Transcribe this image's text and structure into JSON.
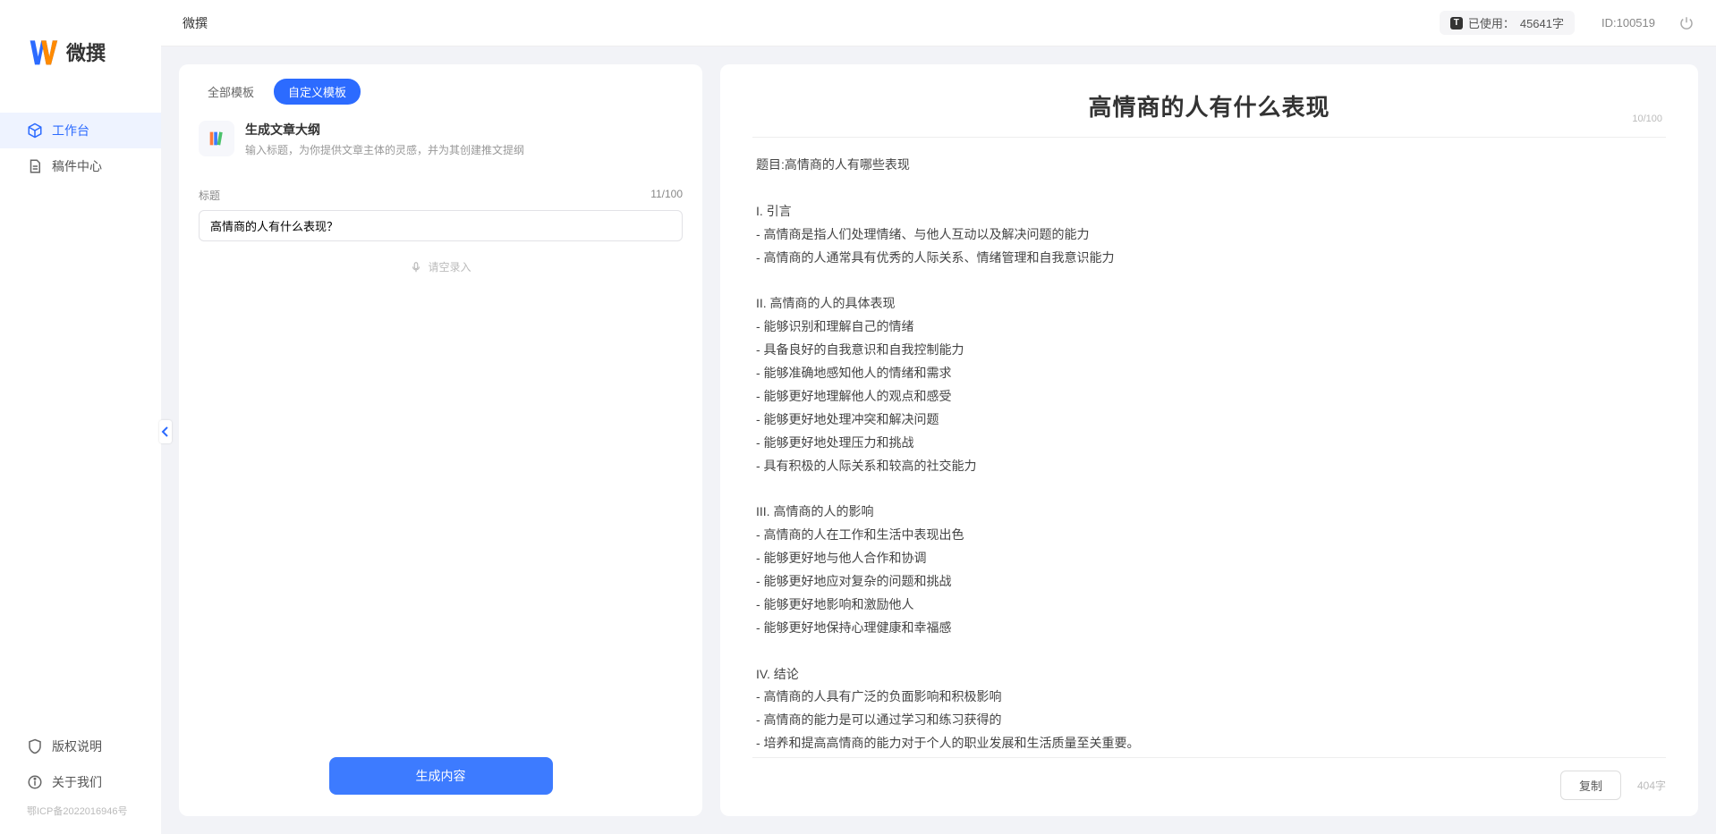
{
  "app": {
    "logo_text": "微撰",
    "nav": [
      {
        "label": "工作台",
        "icon": "cube-icon",
        "active": true
      },
      {
        "label": "稿件中心",
        "icon": "document-icon",
        "active": false
      }
    ],
    "footer_nav": [
      {
        "label": "版权说明",
        "icon": "shield-icon"
      },
      {
        "label": "关于我们",
        "icon": "info-icon"
      }
    ],
    "icp": "鄂ICP备2022016946号"
  },
  "topbar": {
    "breadcrumb": "微撰",
    "usage_prefix": "已使用：",
    "usage_value": "45641字",
    "user_id": "ID:100519"
  },
  "left": {
    "tabs": [
      {
        "label": "全部模板",
        "active": false
      },
      {
        "label": "自定义模板",
        "active": true
      }
    ],
    "template": {
      "title": "生成文章大纲",
      "desc": "输入标题，为你提供文章主体的灵感，并为其创建推文提纲"
    },
    "field_label": "标题",
    "field_counter": "11/100",
    "field_value": "高情商的人有什么表现？",
    "voice_hint": "请空录入",
    "generate_label": "生成内容"
  },
  "right": {
    "title": "高情商的人有什么表现",
    "title_counter": "10/100",
    "body": "题目:高情商的人有哪些表现\n\nI. 引言\n- 高情商是指人们处理情绪、与他人互动以及解决问题的能力\n- 高情商的人通常具有优秀的人际关系、情绪管理和自我意识能力\n\nII. 高情商的人的具体表现\n- 能够识别和理解自己的情绪\n- 具备良好的自我意识和自我控制能力\n- 能够准确地感知他人的情绪和需求\n- 能够更好地理解他人的观点和感受\n- 能够更好地处理冲突和解决问题\n- 能够更好地处理压力和挑战\n- 具有积极的人际关系和较高的社交能力\n\nIII. 高情商的人的影响\n- 高情商的人在工作和生活中表现出色\n- 能够更好地与他人合作和协调\n- 能够更好地应对复杂的问题和挑战\n- 能够更好地影响和激励他人\n- 能够更好地保持心理健康和幸福感\n\nIV. 结论\n- 高情商的人具有广泛的负面影响和积极影响\n- 高情商的能力是可以通过学习和练习获得的\n- 培养和提高高情商的能力对于个人的职业发展和生活质量至关重要。",
    "copy_label": "复制",
    "word_count": "404字"
  }
}
